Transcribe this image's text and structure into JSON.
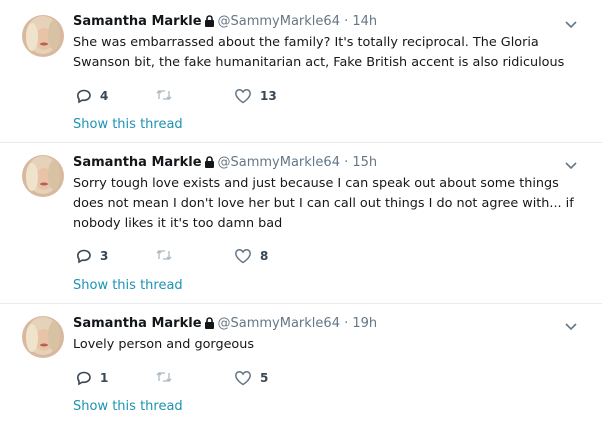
{
  "tweets": [
    {
      "name": "Samantha Markle",
      "handle": "@SammyMarkle64",
      "separator": "·",
      "time": "14h",
      "text": "She was embarrassed about the family? It's totally reciprocal. The Gloria Swanson bit, the fake humanitarian act, Fake British accent is also ridiculous",
      "replies": "4",
      "retweets": "",
      "likes": "13",
      "thread_link": "Show this thread"
    },
    {
      "name": "Samantha Markle",
      "handle": "@SammyMarkle64",
      "separator": "·",
      "time": "15h",
      "text": "Sorry tough love exists and just because I can speak out about some things does not mean I don't love her but I can call out things I do not agree with... if  nobody likes it it's too damn bad",
      "replies": "3",
      "retweets": "",
      "likes": "8",
      "thread_link": "Show this thread"
    },
    {
      "name": "Samantha Markle",
      "handle": "@SammyMarkle64",
      "separator": "·",
      "time": "19h",
      "text": "Lovely person and gorgeous",
      "replies": "1",
      "retweets": "",
      "likes": "5",
      "thread_link": "Show this thread"
    }
  ],
  "icons": {
    "lock": "lock-icon",
    "caret": "chevron-down-icon",
    "reply": "reply-icon",
    "retweet": "retweet-icon",
    "like": "heart-icon"
  },
  "colors": {
    "link": "#1c94b0",
    "muted": "#657786",
    "retweet_inactive": "#aab8c2",
    "divider": "#e6ecf0"
  }
}
